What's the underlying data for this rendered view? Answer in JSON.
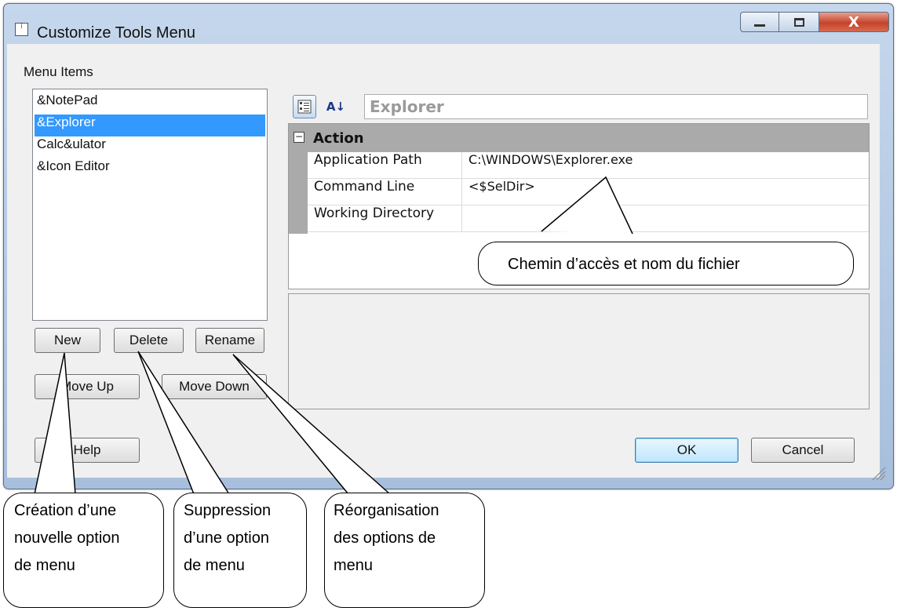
{
  "window": {
    "title": "Customize Tools Menu",
    "title_icon_glyph": "⁞",
    "close_glyph": "X"
  },
  "menu_items": {
    "label": "Menu Items",
    "items": [
      "&NotePad",
      "&Explorer",
      "Calc&ulator",
      "&Icon Editor"
    ],
    "selected_index": 1
  },
  "buttons": {
    "new": "New",
    "delete": "Delete",
    "rename": "Rename",
    "move_up": "Move Up",
    "move_down": "Move Down",
    "help": "Help",
    "ok": "OK",
    "cancel": "Cancel"
  },
  "property_grid": {
    "selected_name": "Explorer",
    "categorized_icon": "categorized-icon",
    "alphabetical_icon": "sort-az-icon",
    "alphabetical_glyph": "A↓",
    "category": {
      "toggle": "−",
      "label": "Action"
    },
    "rows": [
      {
        "name": "Application Path",
        "value": "C:\\WINDOWS\\Explorer.exe"
      },
      {
        "name": "Command Line",
        "value": "<$SelDir>"
      },
      {
        "name": "Working Directory",
        "value": ""
      }
    ]
  },
  "annotations": {
    "path_callout": "Chemin d’accès et nom du fichier",
    "new_callout": "Création d’une\nnouvelle option\nde menu",
    "delete_callout": "Suppression\nd’une option\nde menu",
    "rename_callout": "Réorganisation\ndes options de\nmenu"
  },
  "colors": {
    "selection": "#3399ff",
    "close_button": "#c5432a",
    "category_band": "#aaaaaa"
  }
}
